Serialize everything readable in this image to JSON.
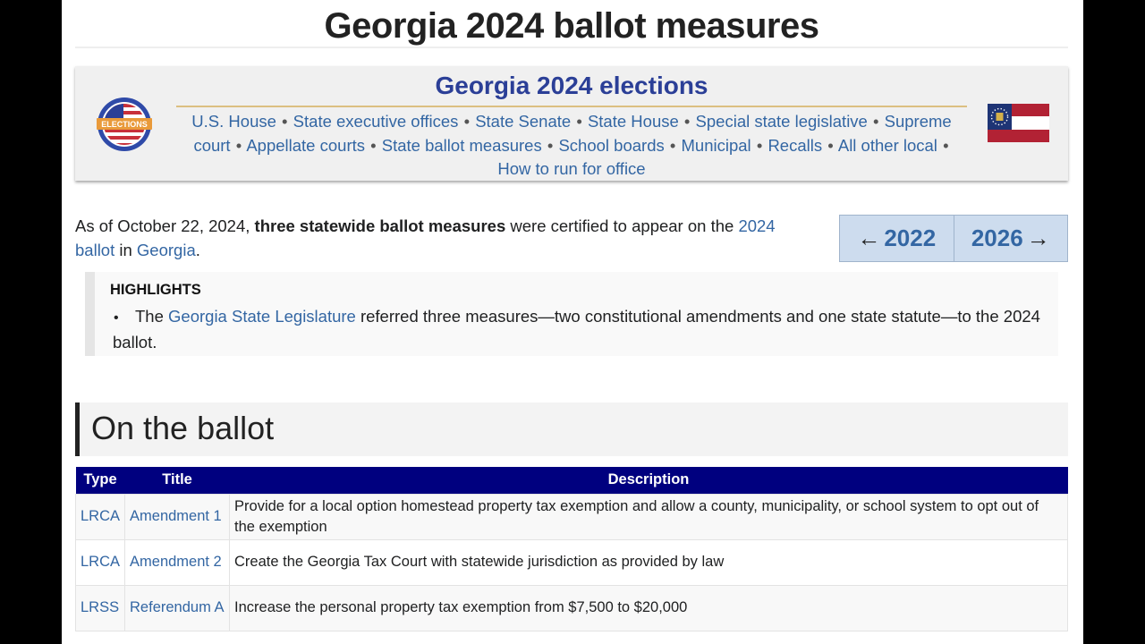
{
  "page_title": "Georgia 2024 ballot measures",
  "nav_box": {
    "heading": "Georgia 2024 elections",
    "logo_label": "ELECTIONS",
    "links": [
      "U.S. House",
      "State executive offices",
      "State Senate",
      "State House",
      "Special state legislative",
      "Supreme court",
      "Appellate courts",
      "State ballot measures",
      "School boards",
      "Municipal",
      "Recalls",
      "All other local",
      "How to run for office"
    ],
    "separator": "•"
  },
  "intro": {
    "prefix": "As of October 22, 2024, ",
    "bold": "three statewide ballot measures",
    "middle": " were certified to appear on the ",
    "link1": "2024 ballot",
    "connector": " in ",
    "link2": "Georgia",
    "suffix": "."
  },
  "year_nav": {
    "prev_arrow": "←",
    "prev_year": "2022",
    "next_year": "2026",
    "next_arrow": "→"
  },
  "highlights": {
    "heading": "HIGHLIGHTS",
    "bullet": "•",
    "item_prefix": "The ",
    "item_link": "Georgia State Legislature",
    "item_suffix": " referred three measures—two constitutional amendments and one state statute—to the 2024 ballot."
  },
  "section": {
    "heading": "On the ballot"
  },
  "ballot_table": {
    "headers": [
      "Type",
      "Title",
      "Description"
    ],
    "rows": [
      {
        "type": "LRCA",
        "title": "Amendment 1",
        "description": "Provide for a local option homestead property tax exemption and allow a county, municipality, or school system to opt out of the exemption"
      },
      {
        "type": "LRCA",
        "title": "Amendment 2",
        "description": "Create the Georgia Tax Court with statewide jurisdiction as provided by law"
      },
      {
        "type": "LRSS",
        "title": "Referendum A",
        "description": "Increase the personal property tax exemption from $7,500 to $20,000"
      }
    ]
  },
  "colors": {
    "link": "#3366a3",
    "nav_heading": "#2b3f97",
    "table_header": "#00007f",
    "year_nav_bg": "#cddcee"
  }
}
